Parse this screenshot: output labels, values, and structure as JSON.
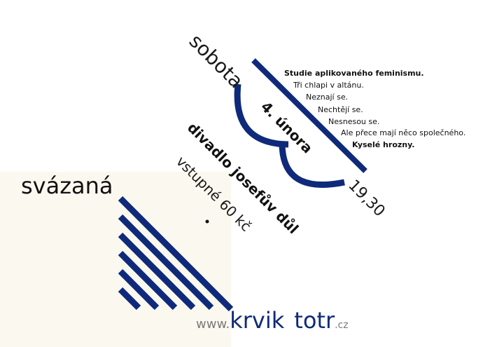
{
  "event": {
    "day": "sobota",
    "date": "4. února",
    "time": "19,30",
    "venue": "divadlo josefův důl",
    "entry": "vstupné 60 kč"
  },
  "taglines": [
    "Studie aplikovaného feminismu.",
    "Tři chlapi v altánu.",
    "Neznají se.",
    "Nechtějí se.",
    "Nesnesou se.",
    "Ale přece mají něco společného.",
    "Kyselé hrozny."
  ],
  "title": "svázaná",
  "website": {
    "prefix": "www.",
    "name": "krvik",
    "name2": "totr",
    "suffix": ".cz"
  },
  "colors": {
    "accent": "#0f2a7a",
    "text": "#111111",
    "muted": "#7a7a7a",
    "panel": "#fbf8ef"
  }
}
